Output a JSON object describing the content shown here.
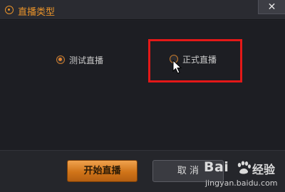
{
  "window": {
    "title": "直播类型",
    "close_label": "✕"
  },
  "options": {
    "test_label": "测试直播",
    "formal_label": "正式直播",
    "selected": "test"
  },
  "footer": {
    "start_label": "开始直播",
    "cancel_label": "取 消"
  },
  "watermark": {
    "brand": "Bai",
    "brand_cn": "经验",
    "url": "jingyan.baidu.com"
  },
  "colors": {
    "accent": "#e9932a",
    "highlight": "#e41818"
  }
}
